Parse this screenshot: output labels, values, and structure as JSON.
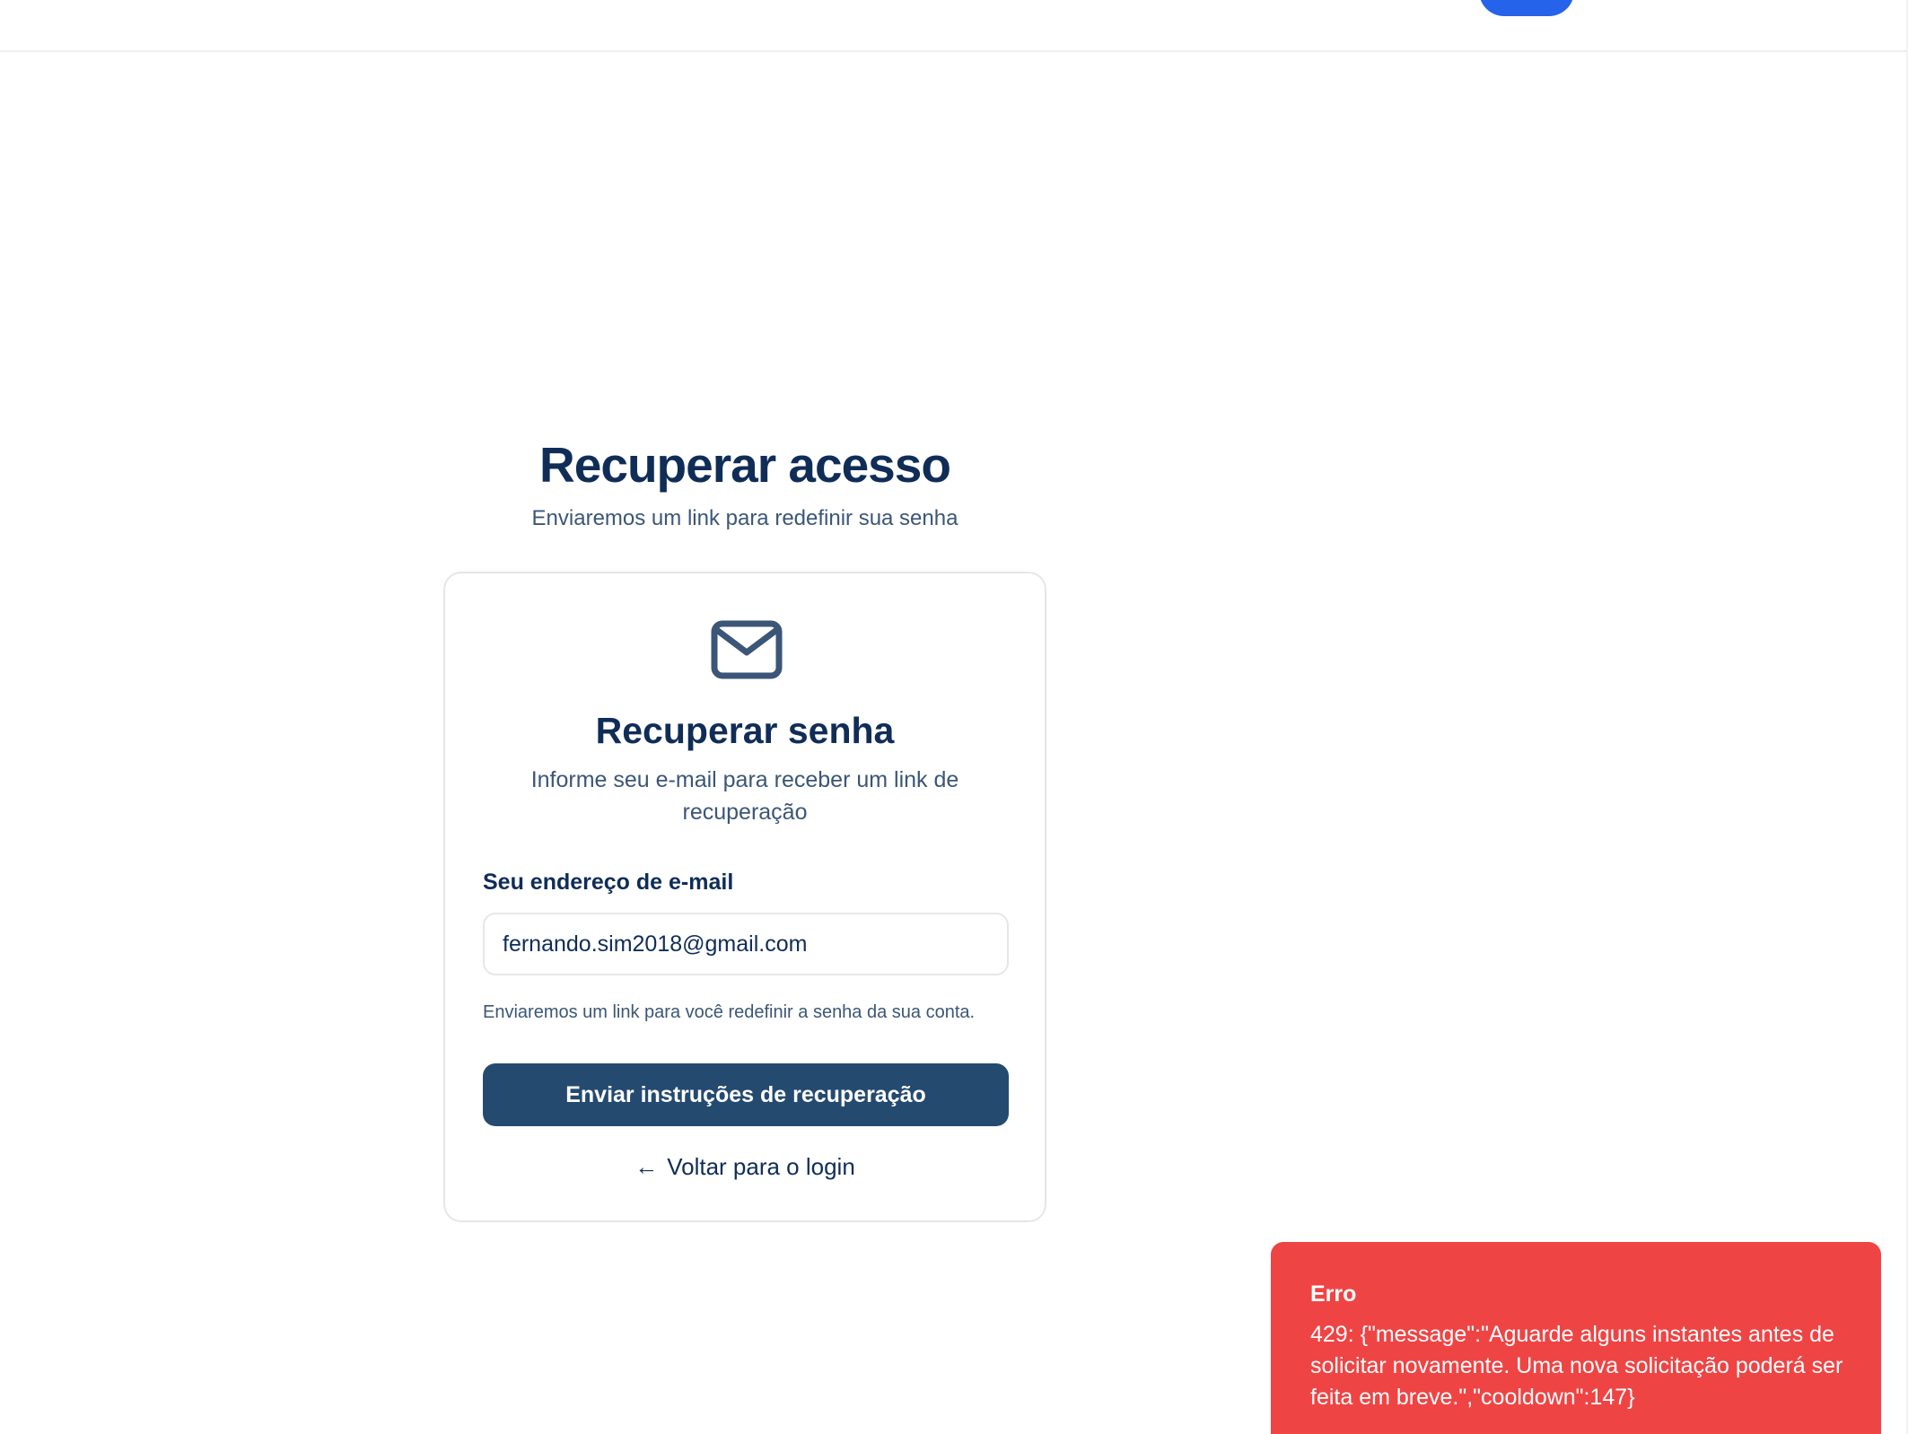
{
  "header": {
    "button_label": ""
  },
  "page": {
    "title": "Recuperar acesso",
    "subtitle": "Enviaremos um link para redefinir sua senha"
  },
  "card": {
    "icon": "mail-icon",
    "title": "Recuperar senha",
    "description": "Informe seu e-mail para receber um link de recuperação",
    "email_label": "Seu endereço de e-mail",
    "email_value": "fernando.sim2018@gmail.com",
    "helper_text": "Enviaremos um link para você redefinir a senha da sua conta.",
    "submit_label": "Enviar instruções de recuperação",
    "back_arrow": "←",
    "back_label": "Voltar para o login"
  },
  "toast": {
    "title": "Erro",
    "message": "429: {\"message\":\"Aguarde alguns instantes antes de solicitar novamente. Uma nova solicitação poderá ser feita em breve.\",\"cooldown\":147}"
  },
  "colors": {
    "primary_dark": "#0f2d57",
    "button": "#254a70",
    "toast_error": "#ef4444",
    "header_button": "#2563eb"
  }
}
